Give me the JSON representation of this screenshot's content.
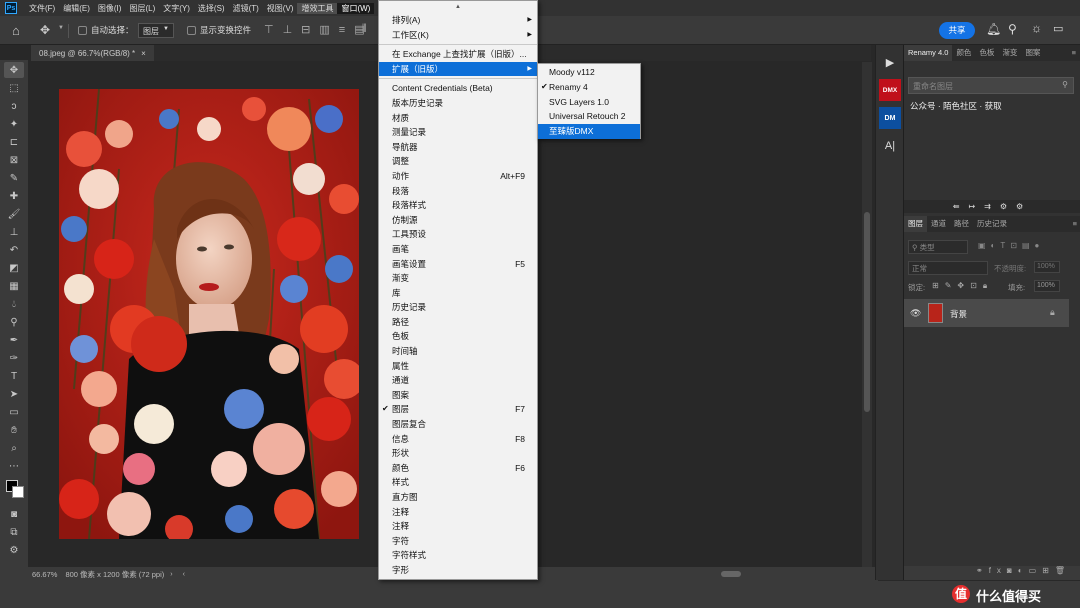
{
  "menubar": {
    "items": [
      "文件(F)",
      "编辑(E)",
      "图像(I)",
      "图层(L)",
      "文字(Y)",
      "选择(S)",
      "滤镜(T)",
      "视图(V)",
      "增效工具",
      "窗口(W)"
    ]
  },
  "optbar": {
    "auto_select": "自动选择：",
    "layer_select": "图层",
    "show_transform": "显示变换控件",
    "share": "共享"
  },
  "document": {
    "tab_title": "08.jpeg @ 66.7%(RGB/8) *",
    "close": "×"
  },
  "status": {
    "zoom": "66.67%",
    "info": "800 像素 x 1200 像素 (72 ppi)"
  },
  "window_menu": {
    "top": [
      {
        "label": "排列(A)",
        "arrow": true
      },
      {
        "label": "工作区(K)",
        "arrow": true
      }
    ],
    "ext": [
      {
        "label": "在 Exchange 上查找扩展（旧版）...",
        "arrow": false
      },
      {
        "label": "扩展（旧版）",
        "arrow": true
      }
    ],
    "items": [
      {
        "label": "Content Credentials (Beta)",
        "shortcut": "",
        "checked": false
      },
      {
        "label": "版本历史记录",
        "shortcut": "",
        "checked": false
      },
      {
        "label": "材质",
        "shortcut": "",
        "checked": false
      },
      {
        "label": "测量记录",
        "shortcut": "",
        "checked": false
      },
      {
        "label": "导航器",
        "shortcut": "",
        "checked": false
      },
      {
        "label": "调整",
        "shortcut": "",
        "checked": false
      },
      {
        "label": "动作",
        "shortcut": "Alt+F9",
        "checked": false
      },
      {
        "label": "段落",
        "shortcut": "",
        "checked": false
      },
      {
        "label": "段落样式",
        "shortcut": "",
        "checked": false
      },
      {
        "label": "仿制源",
        "shortcut": "",
        "checked": false
      },
      {
        "label": "工具预设",
        "shortcut": "",
        "checked": false
      },
      {
        "label": "画笔",
        "shortcut": "",
        "checked": false
      },
      {
        "label": "画笔设置",
        "shortcut": "F5",
        "checked": false
      },
      {
        "label": "渐变",
        "shortcut": "",
        "checked": false
      },
      {
        "label": "库",
        "shortcut": "",
        "checked": false
      },
      {
        "label": "历史记录",
        "shortcut": "",
        "checked": false
      },
      {
        "label": "路径",
        "shortcut": "",
        "checked": false
      },
      {
        "label": "色板",
        "shortcut": "",
        "checked": false
      },
      {
        "label": "时间轴",
        "shortcut": "",
        "checked": false
      },
      {
        "label": "属性",
        "shortcut": "",
        "checked": false
      },
      {
        "label": "通道",
        "shortcut": "",
        "checked": false
      },
      {
        "label": "图案",
        "shortcut": "",
        "checked": false
      },
      {
        "label": "图层",
        "shortcut": "F7",
        "checked": true
      },
      {
        "label": "图层复合",
        "shortcut": "",
        "checked": false
      },
      {
        "label": "信息",
        "shortcut": "F8",
        "checked": false
      },
      {
        "label": "形状",
        "shortcut": "",
        "checked": false
      },
      {
        "label": "颜色",
        "shortcut": "F6",
        "checked": false
      },
      {
        "label": "样式",
        "shortcut": "",
        "checked": false
      },
      {
        "label": "直方图",
        "shortcut": "",
        "checked": false
      },
      {
        "label": "注释",
        "shortcut": "",
        "checked": false
      },
      {
        "label": "注释",
        "shortcut": "",
        "checked": false
      },
      {
        "label": "字符",
        "shortcut": "",
        "checked": false
      },
      {
        "label": "字符样式",
        "shortcut": "",
        "checked": false
      },
      {
        "label": "字形",
        "shortcut": "",
        "checked": false
      }
    ]
  },
  "ext_submenu": [
    {
      "label": "Moody v112",
      "checked": false,
      "hl": false
    },
    {
      "label": "Renamy 4",
      "checked": true,
      "hl": false
    },
    {
      "label": "SVG Layers 1.0",
      "checked": false,
      "hl": false
    },
    {
      "label": "Universal Retouch 2",
      "checked": false,
      "hl": false
    },
    {
      "label": "至臻版DMX",
      "checked": false,
      "hl": true
    }
  ],
  "renamy": {
    "tabs": [
      "Renamy 4.0",
      "颜色",
      "色板",
      "渐变",
      "图案"
    ],
    "search_placeholder": "重命名图层",
    "note": "公众号 · 陌色社区 · 获取"
  },
  "layers": {
    "tabs": [
      "图层",
      "通道",
      "路径",
      "历史记录"
    ],
    "kind": "类型",
    "blend": "正常",
    "opacity_label": "不透明度:",
    "opacity": "100%",
    "lock_label": "锁定:",
    "fill_label": "填充:",
    "fill": "100%",
    "layer_name": "背景"
  },
  "strip": {
    "dmx": "DMX",
    "dm": "DM",
    "text": "A|"
  },
  "watermark": "什么值得买",
  "colors": {
    "accent": "#0d6fd8",
    "share": "#1473e6"
  }
}
